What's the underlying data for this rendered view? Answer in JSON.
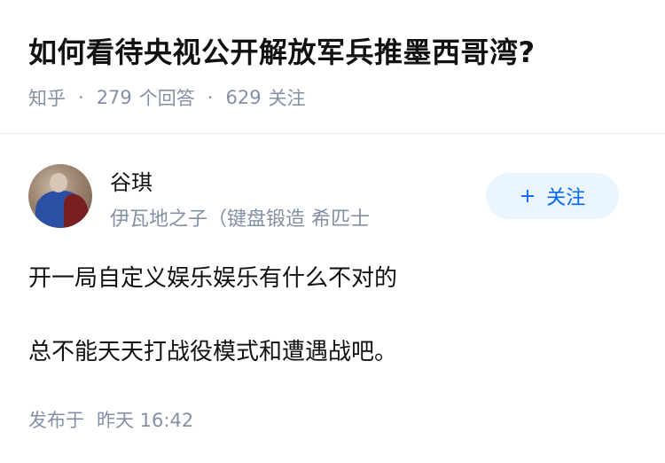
{
  "question": {
    "title": "如何看待央视公开解放军兵推墨西哥湾?",
    "source": "知乎",
    "separator": "·",
    "answers_count": "279",
    "answers_label": "个回答",
    "followers_count": "629",
    "followers_label": "关注"
  },
  "author": {
    "name": "谷琪",
    "bio": "伊瓦地之子（键盘锻造 希匹士",
    "avatar_icon": "user-avatar-photo"
  },
  "follow_button": {
    "icon": "+",
    "label": "关注"
  },
  "answer": {
    "lines": [
      "开一局自定义娱乐娱乐有什么不对的",
      "总不能天天打战役模式和遭遇战吧。"
    ]
  },
  "meta": {
    "published_label": "发布于",
    "published_time": "昨天 16:42"
  },
  "colors": {
    "title": "#121212",
    "muted": "#8590a6",
    "accent": "#0066ff",
    "follow_bg": "#ebf5fd",
    "divider": "#ebebeb"
  }
}
